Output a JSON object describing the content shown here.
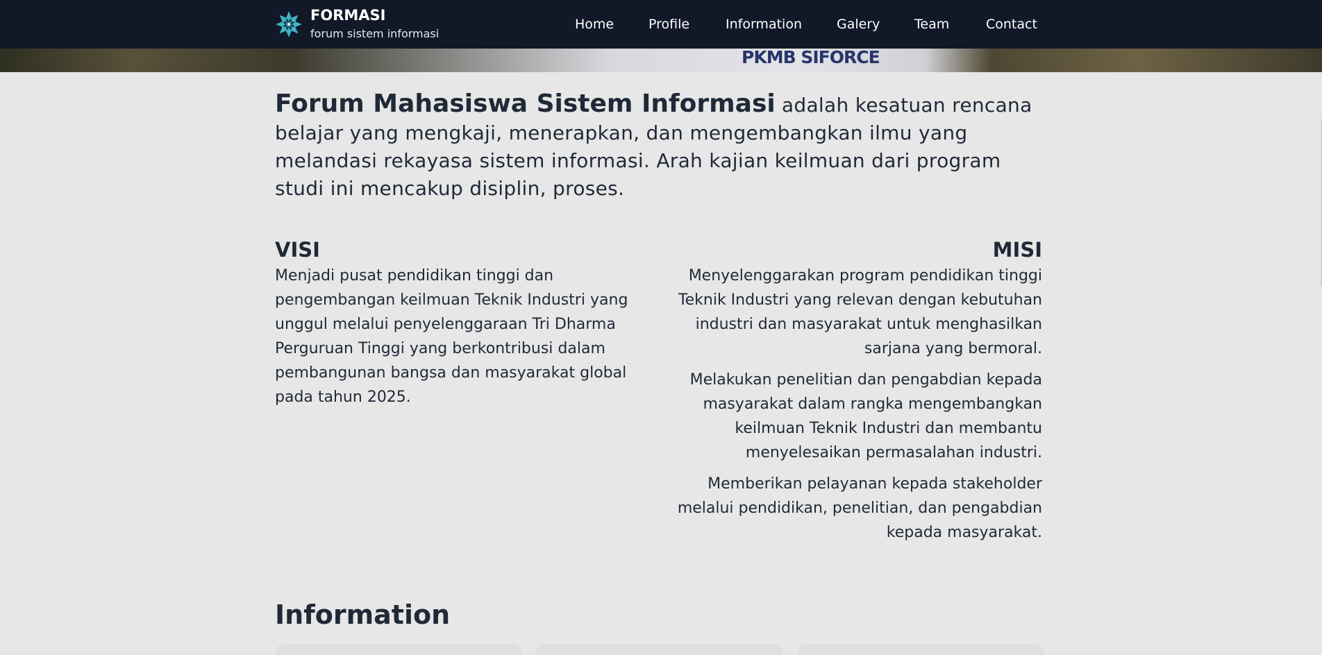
{
  "brand": {
    "title": "FORMASI",
    "subtitle": "forum sistem informasi",
    "logo_icon": "snowflake-logo-icon"
  },
  "nav": {
    "items": [
      {
        "label": "Home"
      },
      {
        "label": "Profile"
      },
      {
        "label": "Information"
      },
      {
        "label": "Galery"
      },
      {
        "label": "Team"
      },
      {
        "label": "Contact"
      }
    ]
  },
  "hero": {
    "shirt_text": "PKMB SIFORCE"
  },
  "intro": {
    "bold": "Forum Mahasiswa Sistem Informasi",
    "text": " adalah kesatuan rencana belajar yang mengkaji, menerapkan, dan mengembangkan ilmu yang melandasi rekayasa sistem informasi. Arah kajian keilmuan dari program studi ini mencakup disiplin, proses."
  },
  "visi": {
    "heading": "VISI",
    "text": "Menjadi pusat pendidikan tinggi dan pengembangan keilmuan Teknik Industri yang unggul melalui penyelenggaraan Tri Dharma Perguruan Tinggi yang berkontribusi dalam pembangunan bangsa dan masyarakat global pada tahun 2025."
  },
  "misi": {
    "heading": "MISI",
    "items": [
      "Menyelenggarakan program pendidikan tinggi Teknik Industri yang relevan dengan kebutuhan industri dan masyarakat untuk menghasilkan sarjana yang bermoral.",
      "Melakukan penelitian dan pengabdian kepada masyarakat dalam rangka mengembangkan keilmuan Teknik Industri dan membantu menyelesaikan permasalahan industri.",
      "Memberikan pelayanan kepada stakeholder melalui pendidikan, penelitian, dan pengabdian kepada masyarakat."
    ]
  },
  "information": {
    "heading": "Information"
  },
  "colors": {
    "navbar": "#111827",
    "background": "#e8e7e7",
    "text": "#1f2937",
    "logo_teal": "#3fb4c4"
  }
}
